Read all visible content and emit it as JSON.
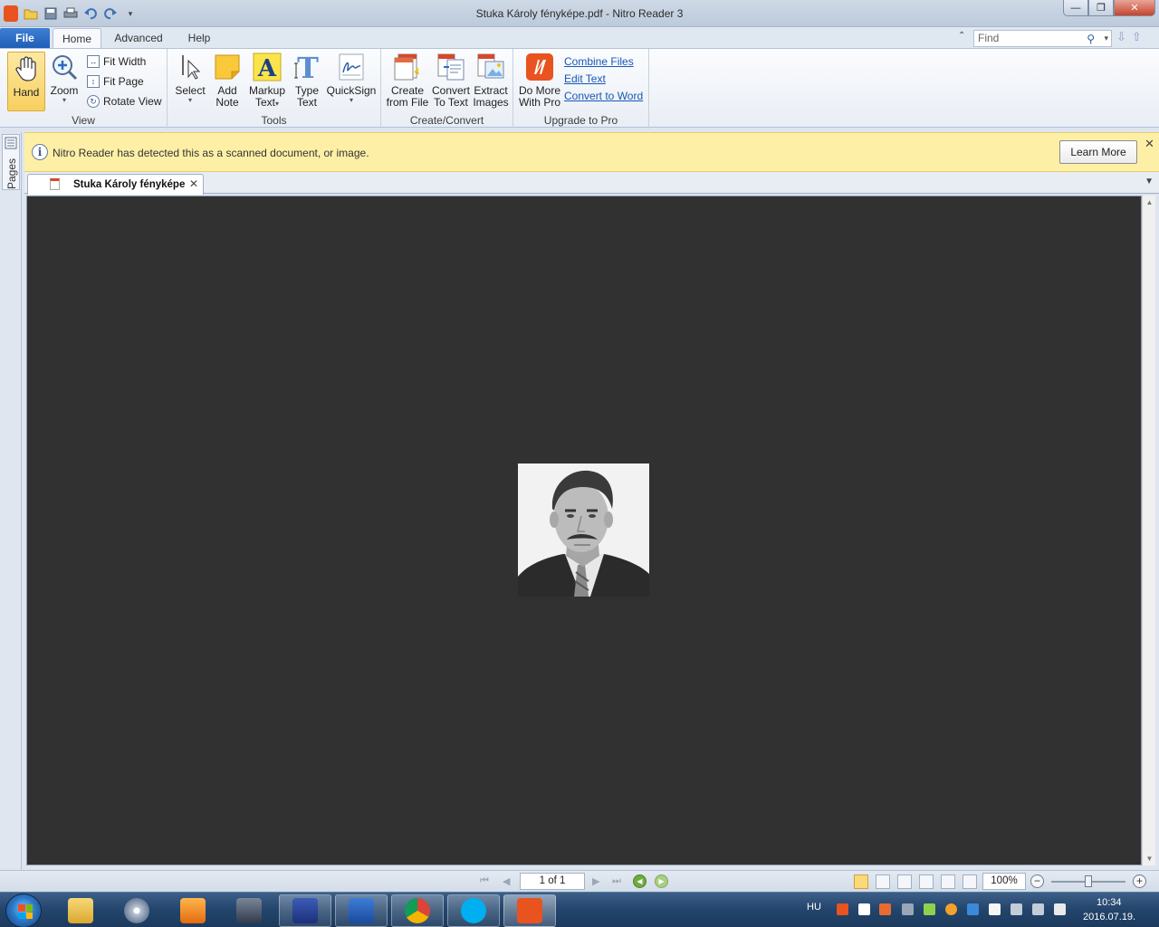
{
  "window": {
    "title": "Stuka Károly fényképe.pdf - Nitro Reader 3",
    "controls": {
      "minimize": "—",
      "maximize": "❐",
      "close": "✕"
    }
  },
  "ribbon_tabs": {
    "file": "File",
    "tabs": [
      {
        "label": "Home",
        "active": true
      },
      {
        "label": "Advanced",
        "active": false
      },
      {
        "label": "Help",
        "active": false
      }
    ]
  },
  "search": {
    "placeholder": "Find"
  },
  "ribbon": {
    "view": {
      "label": "View",
      "hand": "Hand",
      "zoom": "Zoom",
      "fit_width": "Fit Width",
      "fit_page": "Fit Page",
      "rotate_view": "Rotate View"
    },
    "tools": {
      "label": "Tools",
      "select": "Select",
      "add_note_1": "Add",
      "add_note_2": "Note",
      "markup_1": "Markup",
      "markup_2": "Text",
      "type_1": "Type",
      "type_2": "Text",
      "quicksign": "QuickSign"
    },
    "create": {
      "label": "Create/Convert",
      "create_1": "Create",
      "create_2": "from File",
      "convert_1": "Convert",
      "convert_2": "To Text",
      "extract_1": "Extract",
      "extract_2": "Images"
    },
    "upgrade": {
      "label": "Upgrade to Pro",
      "domore_1": "Do More",
      "domore_2": "With Pro",
      "combine": "Combine Files",
      "edit": "Edit Text",
      "convert_word": "Convert to Word"
    }
  },
  "sidepanel": {
    "pages": "Pages"
  },
  "infobar": {
    "message": "Nitro Reader has detected this as a scanned document, or image.",
    "learn_more": "Learn More"
  },
  "document_tab": {
    "title": "Stuka Károly fényképe"
  },
  "statusbar": {
    "page": "1 of 1",
    "zoom": "100%"
  },
  "taskbar": {
    "language": "HU",
    "time": "10:34",
    "date": "2016.07.19."
  },
  "colors": {
    "accent": "#1f5fb8",
    "nitro_orange": "#e8531f",
    "viewer_bg": "#313131",
    "infobar_bg": "#fdf0a6"
  }
}
